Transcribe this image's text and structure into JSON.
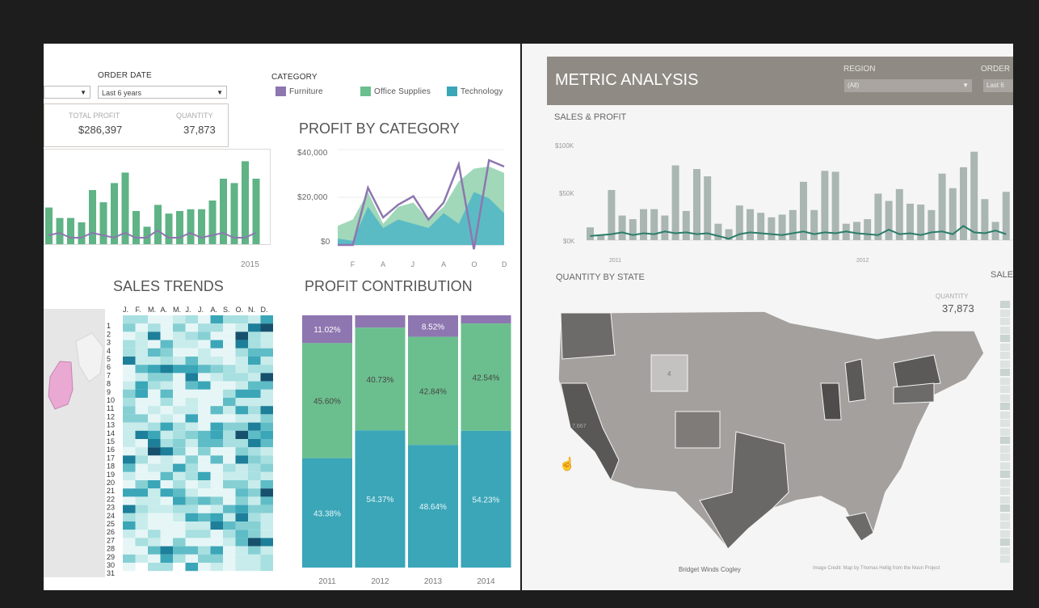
{
  "left": {
    "filters": {
      "order_date_label": "ORDER DATE",
      "order_date_value": "Last 6 years",
      "category_label": "CATEGORY"
    },
    "legend": [
      {
        "label": "Furniture",
        "color": "#8e76b0"
      },
      {
        "label": "Office Supplies",
        "color": "#6bbf8e"
      },
      {
        "label": "Technology",
        "color": "#3aa6b8"
      }
    ],
    "kpis": {
      "total_profit_label": "TOTAL PROFIT",
      "total_profit_value": "$286,397",
      "quantity_label": "QUANTITY",
      "quantity_value": "37,873"
    },
    "sales_mini": {
      "year_label": "2015"
    },
    "profit_by_category": {
      "title": "PROFIT BY CATEGORY",
      "y_ticks": [
        "$40,000",
        "$20,000",
        "$0"
      ]
    },
    "sales_trends": {
      "title": "SALES TRENDS"
    },
    "profit_contribution": {
      "title": "PROFIT CONTRIBUTION",
      "columns": [
        {
          "year": "2011",
          "labels": [
            "11.02%",
            "45.60%",
            "43.38%"
          ]
        },
        {
          "year": "2012",
          "labels": [
            "",
            "40.73%",
            "54.37%"
          ]
        },
        {
          "year": "2013",
          "labels": [
            "8.52%",
            "42.84%",
            "48.64%"
          ]
        },
        {
          "year": "2014",
          "labels": [
            "",
            "42.54%",
            "54.23%"
          ]
        }
      ]
    }
  },
  "right": {
    "title": "METRIC ANALYSIS",
    "region_label": "REGION",
    "region_value": "(All)",
    "order_label": "ORDER",
    "order_value": "Last 6",
    "sales_profit_title": "SALES & PROFIT",
    "y_ticks": [
      "$100K",
      "$50K",
      "$0K"
    ],
    "x_ticks": [
      "2011",
      "2012"
    ],
    "quantity_by_state_title": "QUANTITY BY STATE",
    "sale_label": "SALE",
    "quantity_label": "QUANTITY",
    "quantity_value": "37,873",
    "state_labels": [
      "4",
      "7,667"
    ],
    "credit_left": "Bridget Winds Cogley",
    "credit_right": "Image Credit: Map by Thomas Hellig from the Noun Project"
  },
  "chart_data": [
    {
      "type": "bar",
      "title": "",
      "values": [
        42,
        30,
        30,
        25,
        62,
        48,
        70,
        82,
        38,
        20,
        45,
        35,
        38,
        40,
        40,
        50,
        75,
        70,
        95,
        75
      ]
    },
    {
      "type": "area",
      "title": "PROFIT BY CATEGORY",
      "categories": [
        "J",
        "F",
        "M",
        "A",
        "M",
        "J",
        "J",
        "A",
        "S",
        "O",
        "N",
        "D"
      ],
      "x_tick_labels": [
        "F",
        "A",
        "J",
        "A",
        "O",
        "D"
      ],
      "ylim": [
        0,
        45000
      ],
      "series": [
        {
          "name": "Office Supplies",
          "values": [
            9000,
            12000,
            25000,
            10000,
            18000,
            20000,
            12000,
            18000,
            30000,
            36000,
            37000,
            34000
          ]
        },
        {
          "name": "Technology",
          "values": [
            3000,
            2000,
            18000,
            8000,
            12000,
            10000,
            8000,
            15000,
            10000,
            25000,
            22000,
            15000
          ]
        },
        {
          "name": "Furniture",
          "values": [
            0,
            0,
            27000,
            13000,
            19000,
            23000,
            12000,
            20000,
            38000,
            -2000,
            40000,
            37000
          ]
        }
      ]
    },
    {
      "type": "bar",
      "title": "PROFIT CONTRIBUTION",
      "categories": [
        "2011",
        "2012",
        "2013",
        "2014"
      ],
      "series": [
        {
          "name": "Technology",
          "values": [
            43.38,
            54.37,
            48.64,
            54.23
          ]
        },
        {
          "name": "Office Supplies",
          "values": [
            45.6,
            40.73,
            42.84,
            42.54
          ]
        },
        {
          "name": "Furniture",
          "values": [
            11.02,
            4.9,
            8.52,
            3.23
          ]
        }
      ]
    },
    {
      "type": "bar",
      "title": "SALES & PROFIT",
      "ylim": [
        0,
        110000
      ],
      "values": [
        14000,
        5000,
        55000,
        27000,
        23000,
        34000,
        34000,
        27000,
        82000,
        32000,
        78000,
        70000,
        18000,
        12000,
        38000,
        34000,
        30000,
        25000,
        28000,
        33000,
        64000,
        33000,
        76000,
        75000,
        18000,
        20000,
        23000,
        51000,
        43000,
        56000,
        40000,
        39000,
        33000,
        73000,
        57000,
        80000,
        97000,
        45000,
        20000,
        53000
      ],
      "profit": [
        1000,
        2000,
        3000,
        5000,
        2000,
        4000,
        3000,
        6000,
        4000,
        5000,
        3000,
        4000,
        1000,
        -2000,
        3000,
        5000,
        4000,
        3000,
        2000,
        4000,
        6000,
        3000,
        5000,
        4000,
        6000,
        4000,
        3000,
        2000,
        8000,
        3000,
        4000,
        2000,
        5000,
        6000,
        3000,
        12000,
        5000,
        4000,
        7000,
        3000
      ]
    }
  ]
}
